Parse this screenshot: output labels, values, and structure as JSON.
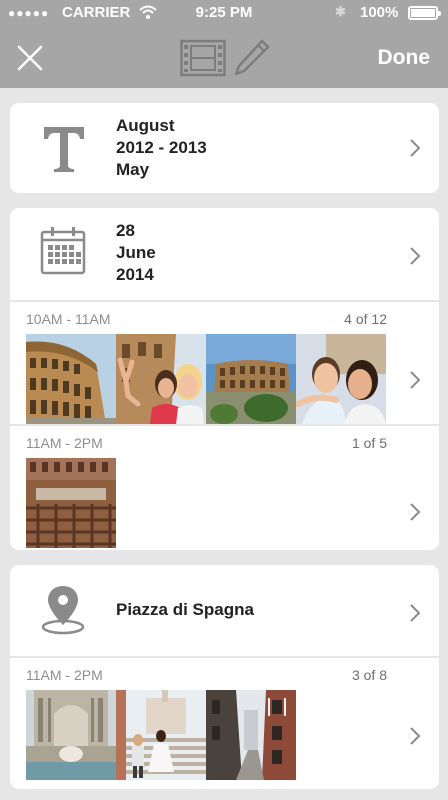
{
  "status_bar": {
    "signal": "●●●●●",
    "carrier": "CARRIER",
    "time": "9:25 PM",
    "battery": "100%"
  },
  "nav": {
    "close_icon": "close-icon",
    "film_icon": "film-icon",
    "edit_icon": "pencil-icon",
    "done_label": "Done"
  },
  "sections": {
    "title": {
      "icon": "text-icon",
      "lines": [
        "August",
        "2012 - 2013",
        "May"
      ]
    },
    "date": {
      "icon": "calendar-icon",
      "lines": [
        "28",
        "June",
        "2014"
      ],
      "groups": [
        {
          "time": "10AM - 11AM",
          "count": "4 of 12"
        },
        {
          "time": "11AM - 2PM",
          "count": "1 of 5"
        }
      ]
    },
    "place": {
      "icon": "location-pin-icon",
      "label": "Piazza di Spagna",
      "groups": [
        {
          "time": "11AM - 2PM",
          "count": "3 of 8"
        }
      ]
    }
  },
  "colors": {
    "navbar": "#a6a6a6",
    "background": "#e6e6e6",
    "icon_gray": "#8a8a8a"
  }
}
